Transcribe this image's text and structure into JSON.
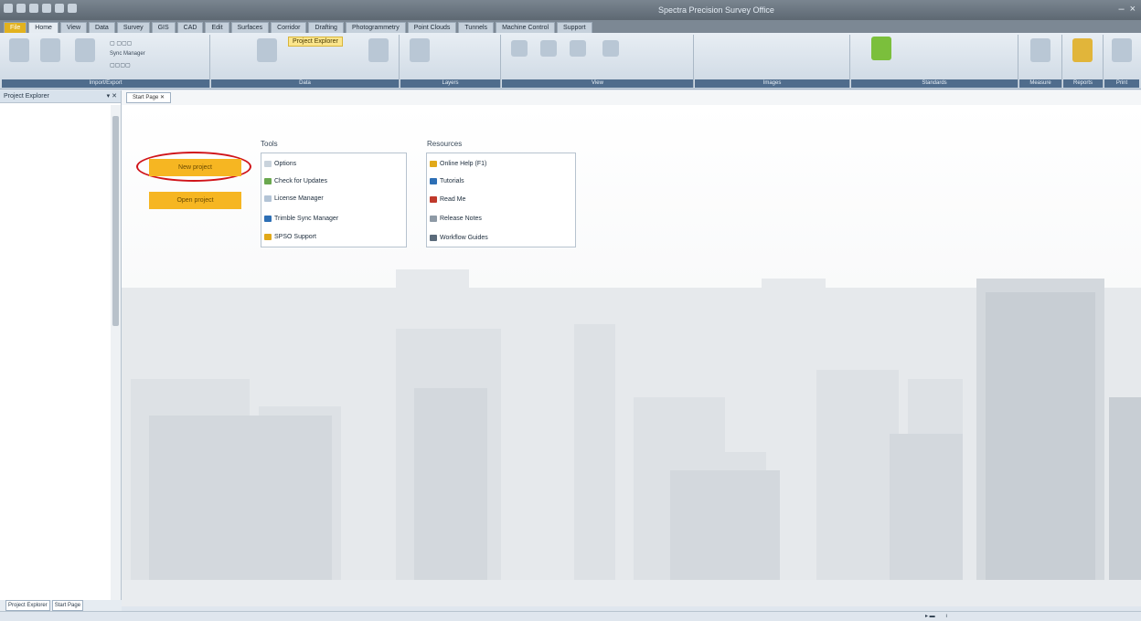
{
  "window": {
    "title": "Spectra Precision Survey Office"
  },
  "ribbon": {
    "tabs": [
      {
        "label": "File"
      },
      {
        "label": "Home"
      },
      {
        "label": "View"
      },
      {
        "label": "Data"
      },
      {
        "label": "Survey"
      },
      {
        "label": "GIS"
      },
      {
        "label": "CAD"
      },
      {
        "label": "Edit"
      },
      {
        "label": "Surfaces"
      },
      {
        "label": "Corridor"
      },
      {
        "label": "Drafting"
      },
      {
        "label": "Photogrammetry"
      },
      {
        "label": "Point Clouds"
      },
      {
        "label": "Tunnels"
      },
      {
        "label": "Machine Control"
      },
      {
        "label": "Support"
      }
    ],
    "project_explorer_label": "Project Explorer",
    "sync_manager_label": "Sync Manager",
    "groups": [
      {
        "label": "Import/Export"
      },
      {
        "label": "Data"
      },
      {
        "label": "Layers"
      },
      {
        "label": "View"
      },
      {
        "label": "Images"
      },
      {
        "label": "Standards"
      },
      {
        "label": "Measure"
      },
      {
        "label": "Reports"
      },
      {
        "label": "Print"
      }
    ]
  },
  "left_pane": {
    "title": "Project Explorer",
    "bottom_tabs": [
      "Project Explorer",
      "Start Page"
    ]
  },
  "document": {
    "tab_label": "Start Page",
    "new_project_label": "New project",
    "open_project_label": "Open project",
    "tools": {
      "title": "Tools",
      "items": [
        {
          "label": "Options",
          "icon": "options-icon",
          "color": "#c9d3dc"
        },
        {
          "label": "Check for Updates",
          "icon": "update-icon",
          "color": "#6aa84f"
        },
        {
          "label": "License Manager",
          "icon": "license-icon",
          "color": "#b3c4d6"
        },
        {
          "label": "Trimble Sync Manager",
          "icon": "sync-icon",
          "color": "#2d6fb5"
        },
        {
          "label": "SPSO Support",
          "icon": "support-icon",
          "color": "#e1a91a"
        }
      ]
    },
    "resources": {
      "title": "Resources",
      "items": [
        {
          "label": "Online Help (F1)",
          "icon": "help-icon",
          "color": "#e1a91a"
        },
        {
          "label": "Tutorials",
          "icon": "tutorials-icon",
          "color": "#2d6fb5"
        },
        {
          "label": "Read Me",
          "icon": "readme-icon",
          "color": "#c0392b"
        },
        {
          "label": "Release Notes",
          "icon": "notes-icon",
          "color": "#8e9aa6"
        },
        {
          "label": "Workflow Guides",
          "icon": "guides-icon",
          "color": "#5b6b7b"
        }
      ]
    }
  },
  "colors": {
    "accent": "#f6b622",
    "highlight_ring": "#d0141a",
    "ribbon_group_label": "#4f6c8c"
  }
}
